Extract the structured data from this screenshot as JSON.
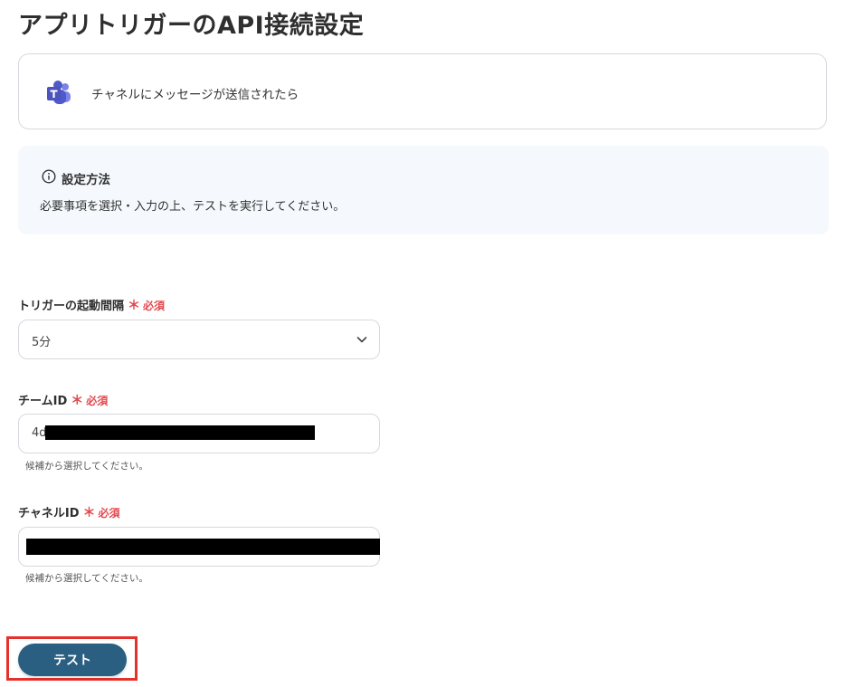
{
  "page": {
    "title": "アプリトリガーのAPI接続設定"
  },
  "trigger": {
    "app_icon": "microsoft-teams-icon",
    "label": "チャネルにメッセージが送信されたら"
  },
  "info": {
    "icon": "info-icon",
    "title": "設定方法",
    "text": "必要事項を選択・入力の上、テストを実行してください。"
  },
  "fields": {
    "interval": {
      "label": "トリガーの起動間隔",
      "required_mark": "＊",
      "required_text": "必須",
      "value": "5分"
    },
    "team_id": {
      "label": "チームID",
      "required_mark": "＊",
      "required_text": "必須",
      "value": "4d",
      "hint": "候補から選択してください。"
    },
    "channel_id": {
      "label": "チャネルID",
      "required_mark": "＊",
      "required_text": "必須",
      "value": "",
      "hint": "候補から選択してください。"
    }
  },
  "actions": {
    "test_label": "テスト"
  },
  "colors": {
    "accent": "#2a5f82",
    "required": "#e3484d",
    "highlight": "#e5302c",
    "info_bg": "#f5f8fc"
  }
}
